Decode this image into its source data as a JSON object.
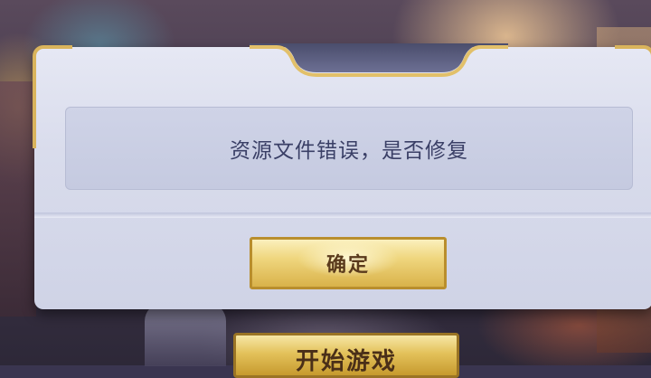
{
  "dialog": {
    "message": "资源文件错误，是否修复",
    "confirm_label": "确定"
  },
  "background": {
    "start_game_label": "开始游戏"
  },
  "colors": {
    "gold_border": "#d9b45c",
    "dialog_bg": "#d9dcec",
    "message_text": "#3a3f66",
    "button_text": "#5a3a1c"
  }
}
